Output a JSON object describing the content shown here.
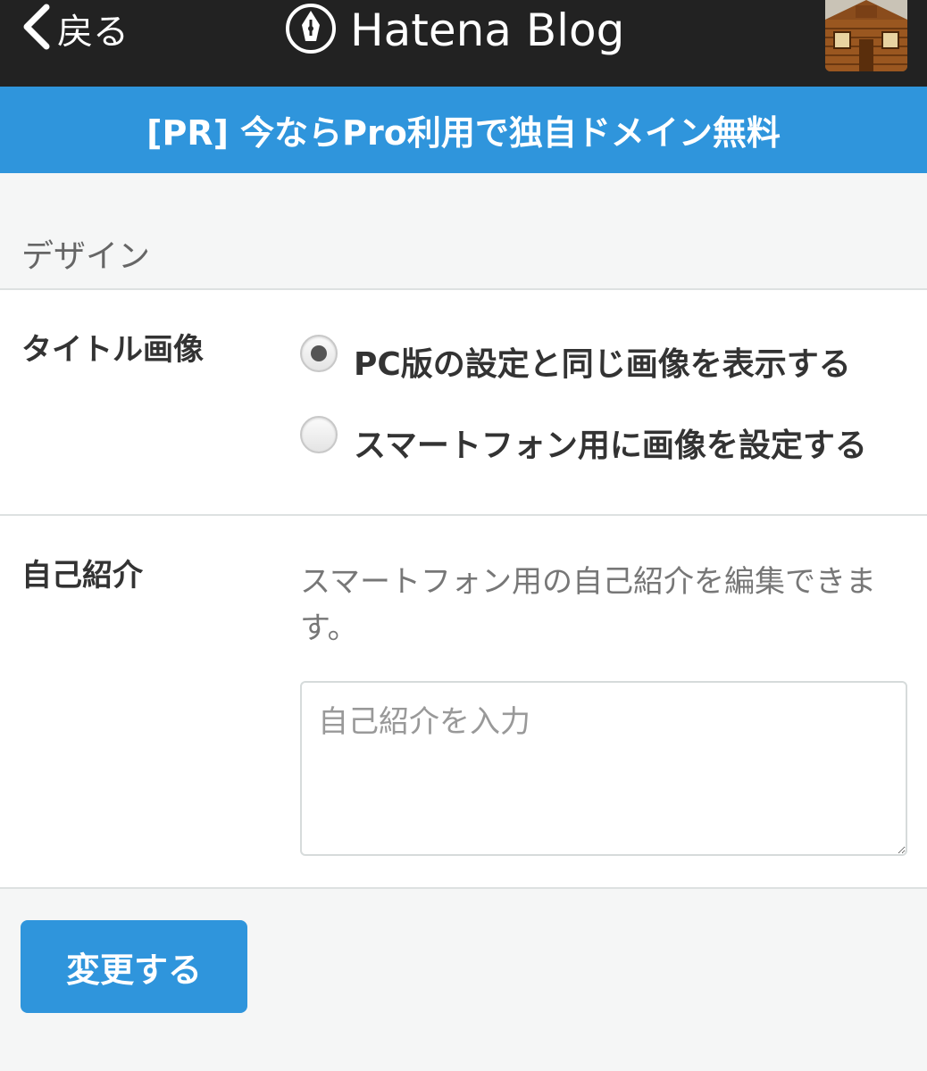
{
  "header": {
    "back_label": "戻る",
    "logo_text": "Hatena Blog",
    "icons": {
      "back": "chevron-left-icon",
      "logo": "hatena-pen-icon",
      "avatar": "user-avatar"
    }
  },
  "banner": {
    "text": "[PR] 今ならPro利用で独自ドメイン無料"
  },
  "section": {
    "title": "デザイン"
  },
  "title_image": {
    "label": "タイトル画像",
    "options": [
      {
        "label": "PC版の設定と同じ画像を表示する",
        "selected": true
      },
      {
        "label": "スマートフォン用に画像を設定する",
        "selected": false
      }
    ]
  },
  "profile": {
    "label": "自己紹介",
    "help": "スマートフォン用の自己紹介を編集できます。",
    "placeholder": "自己紹介を入力",
    "value": ""
  },
  "actions": {
    "submit_label": "変更する"
  },
  "colors": {
    "accent": "#2f95dc",
    "topbar": "#222222",
    "background": "#f5f6f6"
  }
}
